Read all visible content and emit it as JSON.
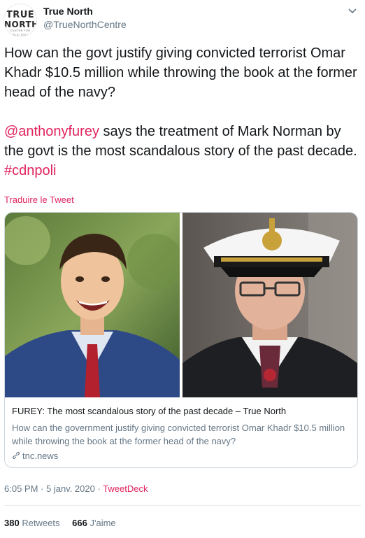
{
  "account": {
    "avatar_line1": "TRUE",
    "avatar_line2": "NORTH",
    "avatar_line3": "CENTRE FOR PUBLIC POLICY",
    "display_name": "True North",
    "handle": "@TrueNorthCentre",
    "caret_icon": "chevron-down-icon"
  },
  "tweet": {
    "paragraph1": "How can the govt justify giving convicted terrorist Omar Khadr $10.5 million while throwing the book at the former head of the navy?",
    "mention": "@anthonyfurey",
    "paragraph2_mid": " says the treatment of Mark Norman by the govt is the most scandalous story of the past decade. ",
    "hashtag": "#cdnpoli",
    "translate_label": "Traduire le Tweet"
  },
  "card": {
    "title": "FUREY: The most scandalous story of the past decade – True North",
    "description": "How can the government justify giving convicted terrorist Omar Khadr $10.5 million while throwing the book at the former head of the navy?",
    "domain": "tnc.news",
    "domain_icon": "link-icon"
  },
  "meta": {
    "time": "6:05 PM",
    "separator": " · ",
    "date": "5 janv. 2020",
    "source": "TweetDeck"
  },
  "stats": {
    "retweets_count": "380",
    "retweets_label": "Retweets",
    "likes_count": "666",
    "likes_label": "J'aime"
  },
  "colors": {
    "accent": "#e0245e",
    "secondary_text": "#657786",
    "primary_text": "#14171a",
    "border": "#ccd6dd"
  }
}
